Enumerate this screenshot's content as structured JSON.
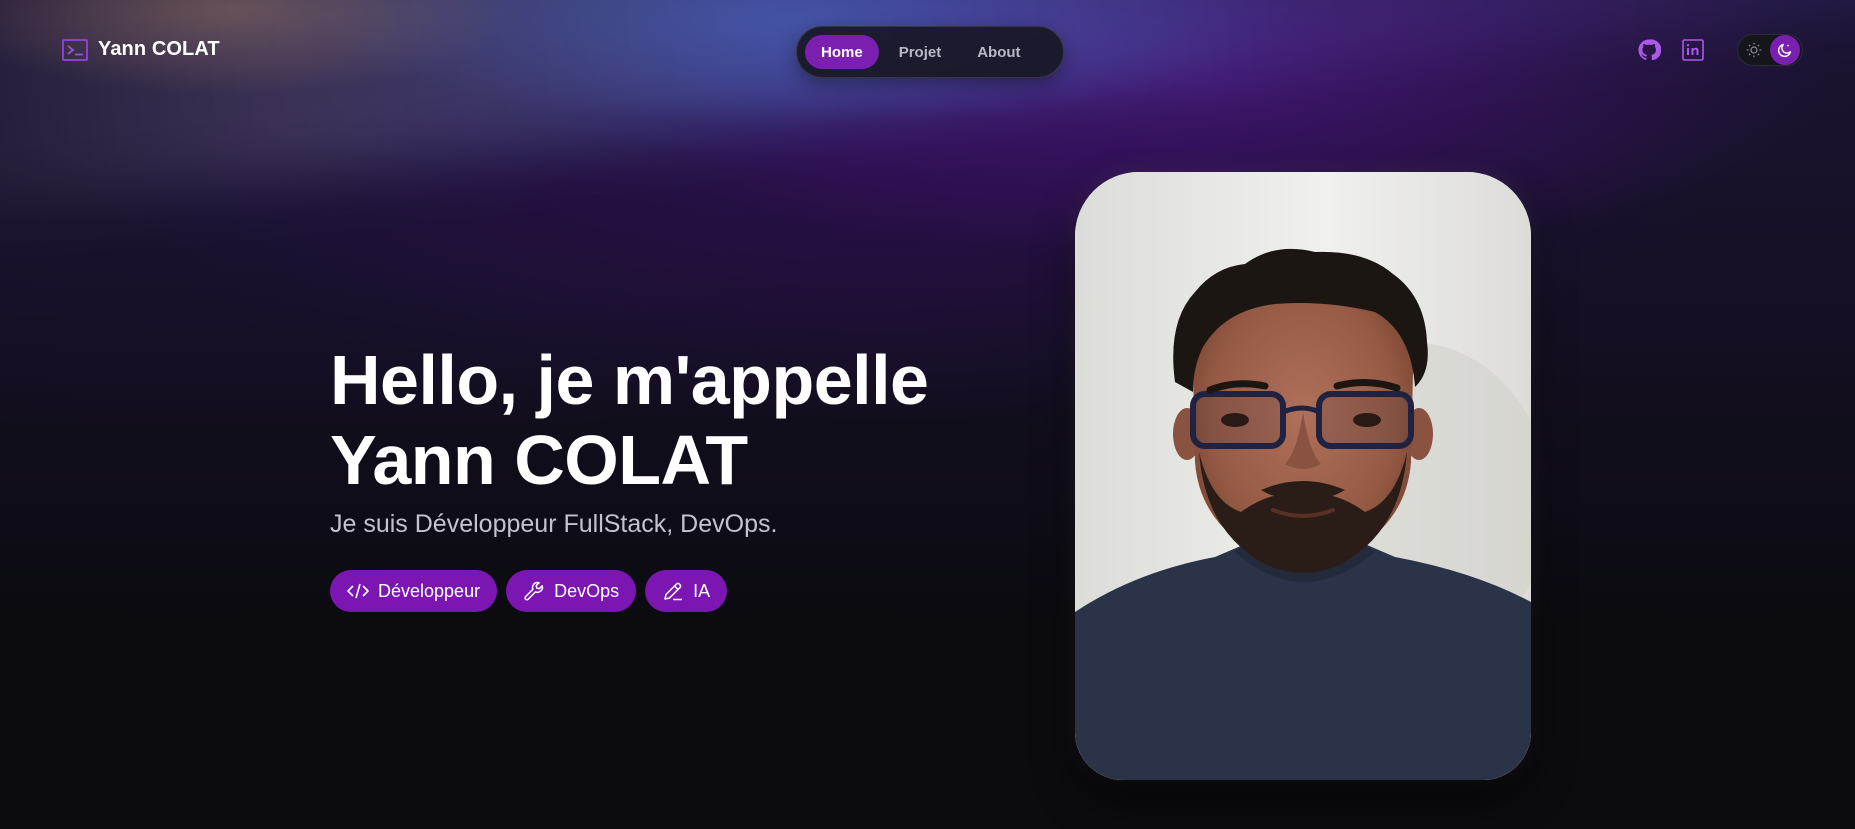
{
  "brand": {
    "icon": "terminal-icon",
    "name": "Yann COLAT"
  },
  "nav": {
    "items": [
      {
        "label": "Home",
        "active": true
      },
      {
        "label": "Projet",
        "active": false
      },
      {
        "label": "About",
        "active": false
      }
    ]
  },
  "header_actions": {
    "github_icon": "github-icon",
    "linkedin_icon": "linkedin-icon",
    "theme_toggle": {
      "sun_icon": "sun-icon",
      "moon_icon": "moon-icon",
      "selected": "dark"
    }
  },
  "hero": {
    "title_line1": "Hello, je m'appelle",
    "title_line2": "Yann COLAT",
    "subtitle": "Je suis Développeur FullStack, DevOps.",
    "tags": [
      {
        "label": "Développeur",
        "icon": "code-icon"
      },
      {
        "label": "DevOps",
        "icon": "wrench-icon"
      },
      {
        "label": "IA",
        "icon": "pencil-icon"
      }
    ]
  },
  "colors": {
    "accent": "#7b1fb0",
    "background": "#0b0b10",
    "text": "#ffffff",
    "muted_text": "#c3c3d0"
  }
}
